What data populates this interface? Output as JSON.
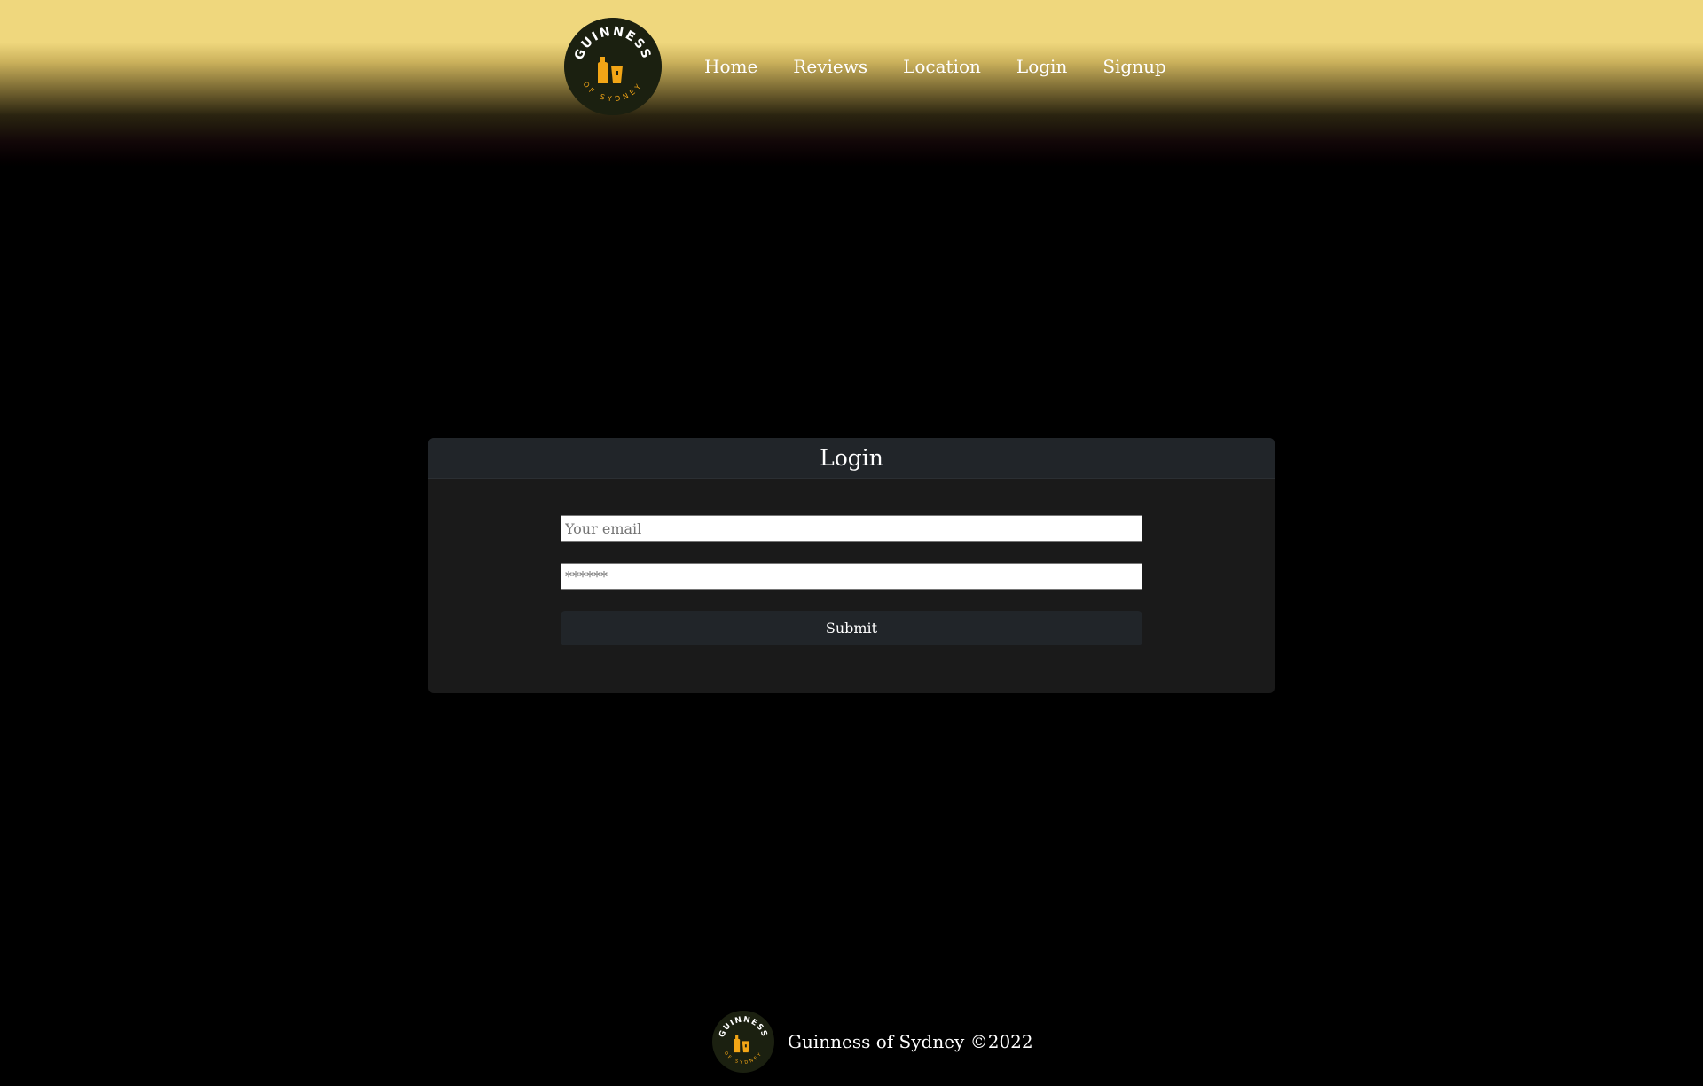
{
  "colors": {
    "header_top": "#efd77d",
    "page_background": "#000000",
    "card_background": "#1a1a1a",
    "card_header_background": "#212529",
    "logo_dark": "#1b2010",
    "logo_accent": "#f2a516"
  },
  "brand": {
    "logo_icon": "guinness-logo-icon",
    "logo_top_text": "GUINNESS",
    "logo_bottom_text": "OF SYDNEY"
  },
  "nav": {
    "items": [
      {
        "label": "Home"
      },
      {
        "label": "Reviews"
      },
      {
        "label": "Location"
      },
      {
        "label": "Login"
      },
      {
        "label": "Signup"
      }
    ]
  },
  "login": {
    "title": "Login",
    "email_placeholder": "Your email",
    "password_placeholder": "******",
    "submit_label": "Submit"
  },
  "footer": {
    "text": "Guinness of Sydney ©2022"
  }
}
